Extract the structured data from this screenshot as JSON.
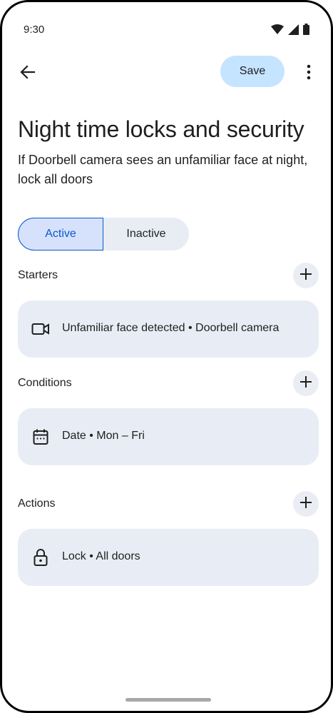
{
  "status_bar": {
    "time": "9:30",
    "icons": [
      "wifi-icon",
      "signal-icon",
      "battery-icon"
    ]
  },
  "toolbar": {
    "save_label": "Save",
    "icons": [
      "back-arrow-icon",
      "more-vert-icon"
    ]
  },
  "header": {
    "title": "Night time locks and security",
    "subtitle": "If Doorbell camera sees an unfamiliar face at night, lock all doors"
  },
  "toggle": {
    "active_label": "Active",
    "inactive_label": "Inactive",
    "selected": "Active"
  },
  "sections": {
    "starters": {
      "label": "Starters",
      "item": {
        "icon": "videocam-icon",
        "text": "Unfamiliar face detected • Doorbell camera"
      }
    },
    "conditions": {
      "label": "Conditions",
      "item": {
        "icon": "calendar-icon",
        "text": "Date • Mon – Fri"
      }
    },
    "actions": {
      "label": "Actions",
      "item": {
        "icon": "lock-icon",
        "text": "Lock • All doors"
      }
    }
  },
  "colors": {
    "accent": "#0b57d0",
    "save_bg": "#c5e4ff",
    "card_bg": "#e8edf5"
  }
}
